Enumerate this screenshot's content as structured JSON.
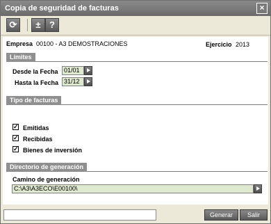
{
  "window": {
    "title": "Copia de seguridad de facturas",
    "close_glyph": "×"
  },
  "toolbar": {
    "buttons": [
      {
        "name": "refresh-icon",
        "glyph": "⟳"
      },
      {
        "name": "plus-minus-icon",
        "glyph": "±"
      },
      {
        "name": "help-icon",
        "glyph": "?"
      }
    ]
  },
  "header": {
    "empresa_label": "Empresa",
    "empresa_value": "00100 - A3 DEMOSTRACIONES",
    "ejercicio_label": "Ejercicio",
    "ejercicio_value": "2013"
  },
  "limites": {
    "title": "Límites",
    "desde_label": "Desde la Fecha",
    "desde_value": "01/01",
    "hasta_label": "Hasta la Fecha",
    "hasta_value": "31/12"
  },
  "tipo": {
    "title": "Tipo de facturas",
    "items": [
      {
        "label": "Emitidas",
        "checked": true
      },
      {
        "label": "Recibidas",
        "checked": true
      },
      {
        "label": "Bienes de inversión",
        "checked": true
      }
    ]
  },
  "directorio": {
    "title": "Directorio de generación",
    "camino_label": "Camino de generación",
    "camino_value": "C:\\A3\\A3ECO\\E00100\\"
  },
  "footer": {
    "status_text": "",
    "generar_label": "Generar",
    "salir_label": "Salir"
  },
  "colors": {
    "field_bg": "#dfe9cf",
    "section_tab": "#8f8f8f",
    "titlebar": "#7a7a7a"
  }
}
